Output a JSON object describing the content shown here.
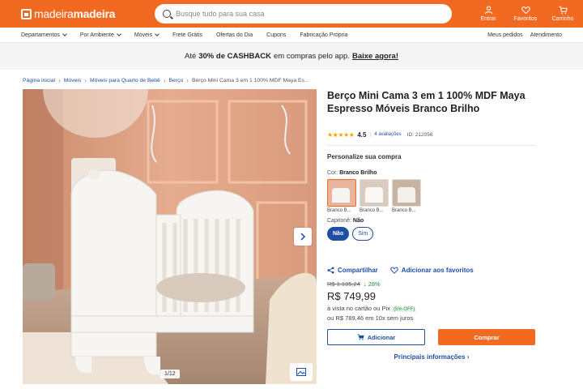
{
  "header": {
    "logo_prefix": "madeira",
    "logo_suffix": "madeira",
    "search_placeholder": "Busque tudo para sua casa",
    "actions": [
      {
        "label": "Entrar",
        "icon": "user-icon"
      },
      {
        "label": "Favoritos",
        "icon": "heart-icon"
      },
      {
        "label": "Carrinho",
        "icon": "cart-icon"
      }
    ]
  },
  "nav": {
    "items": [
      "Departamentos",
      "Por Ambiente",
      "Móveis",
      "Frete Grátis",
      "Ofertas do Dia",
      "Cupons",
      "Fabricação Própria"
    ],
    "right": [
      "Meus pedidos",
      "Atendimento"
    ]
  },
  "promo": {
    "prefix": "Até",
    "highlight": "30% de CASHBACK",
    "middle": "em compras pelo app.",
    "link": "Baixe agora!"
  },
  "breadcrumb": [
    "Página inicial",
    "Móveis",
    "Móveis para Quarto de Bebê",
    "Berço",
    "Berço Mini Cama 3 em 1 100% MDF Maya Es..."
  ],
  "gallery": {
    "counter": "1/12"
  },
  "product": {
    "title": "Berço Mini Cama 3 em 1 100% MDF Maya Espresso Móveis Branco Brilho",
    "stars": "★★★★★",
    "rating": "4.5",
    "reviews": "4 avaliações",
    "id": "ID: 212056",
    "personalize": "Personalize sua compra",
    "color_label": "Cor:",
    "color_value": "Branco Brilho",
    "swatches": [
      "Branco B...",
      "Branco B...",
      "Branco B..."
    ],
    "cap_label": "Capitonê:",
    "cap_value": "Não",
    "cap_options": [
      "Não",
      "Sim"
    ],
    "share": "Compartilhar",
    "favorite": "Adicionar aos favoritos",
    "old_price": "R$ 1.105,24",
    "discount": "28%",
    "price": "R$ 749,99",
    "pay_cash": "à vista no cartão ou Pix",
    "pix_off": "(5% OFF)",
    "installments": "ou R$ 789,46 em 10x sem juros",
    "add_label": "Adicionar",
    "buy_label": "Comprar",
    "main_info": "Principais informações"
  },
  "colors": {
    "brand": "#f26a21",
    "link": "#1e4fa3",
    "discount": "#2a8a3a"
  }
}
